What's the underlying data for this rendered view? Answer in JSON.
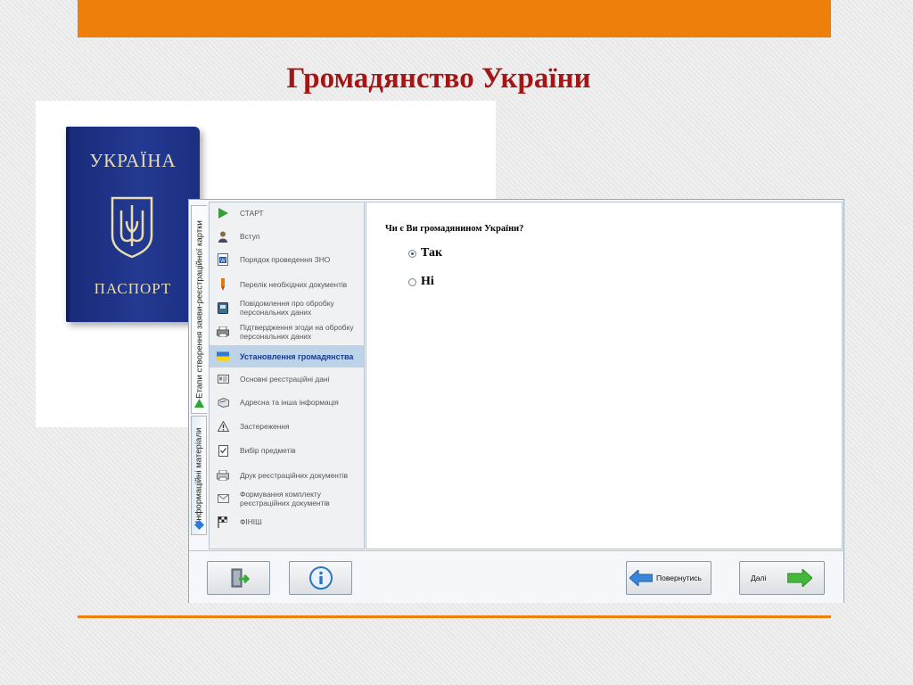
{
  "slide": {
    "title": "Громадянство України"
  },
  "passport": {
    "country": "УКРАЇНА",
    "word": "ПАСПОРТ"
  },
  "app": {
    "vtabs": [
      {
        "label": "Етапи створення заяви-реєстраційної картки",
        "active": true
      },
      {
        "label": "Інформаційні матеріали",
        "active": false
      }
    ],
    "steps": [
      {
        "label": "СТАРТ",
        "icon": "play-icon"
      },
      {
        "label": "Вступ",
        "icon": "person-icon"
      },
      {
        "label": "Порядок проведення ЗНО",
        "icon": "word-doc-icon"
      },
      {
        "label": "Перелік необхідних документів",
        "icon": "pen-icon"
      },
      {
        "label": "Повідомлення про обробку персональних даних",
        "icon": "book-icon"
      },
      {
        "label": "Підтвердження згоди на обробку персональних даних",
        "icon": "printer-icon"
      },
      {
        "label": "Установлення громадянства",
        "icon": "ukraine-flag-icon",
        "active": true
      },
      {
        "label": "Основні реєстраційні дані",
        "icon": "id-card-icon"
      },
      {
        "label": "Адресна та інша інформація",
        "icon": "address-book-icon"
      },
      {
        "label": "Застереження",
        "icon": "warning-icon"
      },
      {
        "label": "Вибір предметів",
        "icon": "checklist-icon"
      },
      {
        "label": "Друк реєстраційних документів",
        "icon": "printer-icon"
      },
      {
        "label": "Формування комплекту реєстраційних документів",
        "icon": "envelope-icon"
      },
      {
        "label": "ФІНІШ",
        "icon": "finish-flag-icon"
      }
    ],
    "question": "Чи є Ви громадянином України?",
    "options": [
      {
        "label": "Так",
        "checked": true
      },
      {
        "label": "Ні",
        "checked": false
      }
    ],
    "buttons": {
      "back_label": "Повернутись",
      "next_label": "Далі"
    }
  },
  "colors": {
    "accent_orange": "#ee7f0a",
    "title_red": "#a41616",
    "passport_blue": "#1f3388",
    "active_step_bg": "#bdd3e8"
  }
}
